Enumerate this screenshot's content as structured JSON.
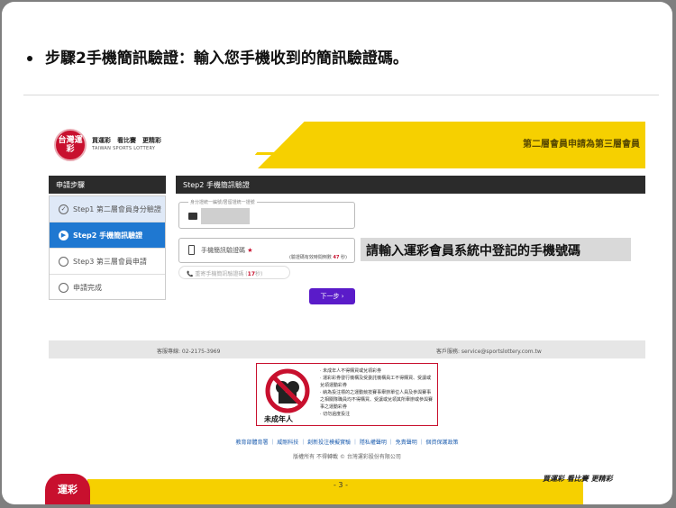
{
  "slide": {
    "title": "步驟2手機簡訊驗證：輸入您手機收到的簡訊驗證碼。",
    "page_number": "- 3 -",
    "bottom_logo": "運彩",
    "slogan": "買運彩 看比賽 更精彩"
  },
  "site": {
    "logo": "台灣運彩",
    "logo_text": "買運彩　看比賽　更精彩",
    "logo_sub": "TAIWAN SPORTS LOTTERY",
    "header_right": "第二層會員申請為第三層會員"
  },
  "sidebar": {
    "title": "申請步驟",
    "items": [
      {
        "label": "Step1 第二層會員身分驗證",
        "state": "done",
        "mark": "✓"
      },
      {
        "label": "Step2 手機簡訊驗證",
        "state": "active",
        "mark": "▶"
      },
      {
        "label": "Step3 第三層會員申請",
        "state": "todo",
        "mark": ""
      },
      {
        "label": "申請完成",
        "state": "todo",
        "mark": ""
      }
    ]
  },
  "main": {
    "title": "Step2 手機簡訊驗證",
    "id_field_legend": "身分證統一編號/居留證統一證號",
    "sms_label": "手機簡訊驗證碼",
    "sms_required": "★",
    "sms_note_prefix": "(驗證碼有效時間倒數",
    "sms_countdown": "47",
    "sms_note_suffix": "秒)",
    "resend_prefix": "重寄手機簡訊驗證碼 (",
    "resend_count": "17",
    "resend_suffix": "秒)",
    "next_button": "下一步 ›",
    "callout": "請輸入運彩會員系統中登記的手機號碼"
  },
  "footer": {
    "phone": "客服專線: 02-2175-3969",
    "email": "客戶服務: service@sportslottery.com.tw",
    "warning_caption": "未成年人",
    "warning_lines": [
      "· 未成年人不得購買或兌領彩券",
      "· 運彩彩券發行機構及受委託機構員工不得購買、受讓或兌領運動彩券",
      "· 納為投注標的之運動競技賽事舉辦單位人員及參與賽事之相關隊職員均不得購買、受讓或兌領其所舉辦或參與賽事之運動彩券",
      "· 切勿過度投注"
    ],
    "links": "教育部體育署 ｜ 威剛科技 ｜ 創新投注模擬實驗 ｜ 隱私權聲明 ｜ 免責聲明 ｜ 個資保護政策",
    "copyright": "版權所有 不得轉載 © 台灣運彩股份有限公司"
  },
  "colors": {
    "brand_yellow": "#f6d000",
    "brand_red": "#c8102e",
    "active_blue": "#1f78d1",
    "button_purple": "#5a1bc9"
  }
}
